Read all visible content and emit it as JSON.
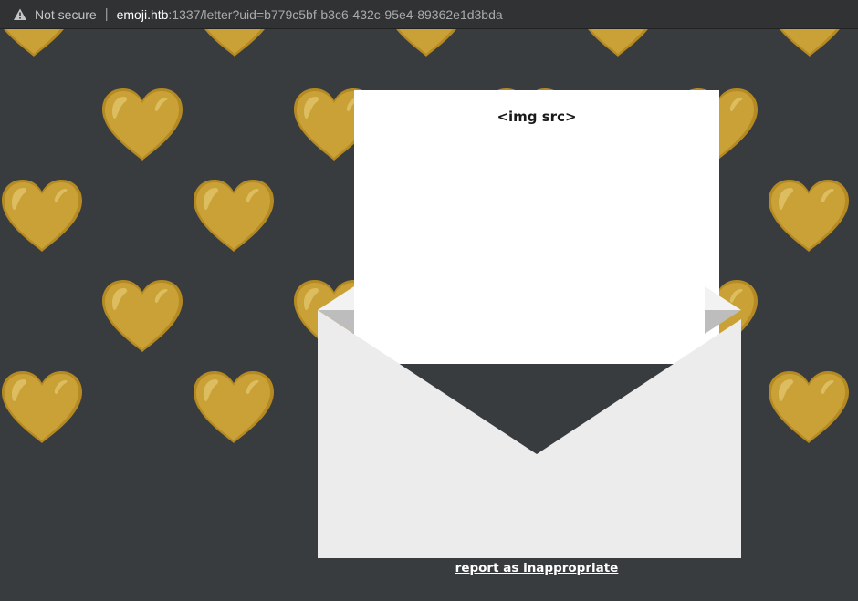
{
  "browser": {
    "security_label": "Not secure",
    "url_host": "emoji.htb",
    "url_path": ":1337/letter?uid=b779c5bf-b3c6-432c-95e4-89362e1d3bda"
  },
  "letter": {
    "text": "<img src>",
    "report_label": "report as inappropriate"
  },
  "colors": {
    "background": "#393c3e",
    "heart_gold": "#c89f2f",
    "paper": "#ffffff",
    "envelope": "#ececec"
  },
  "icons": {
    "background_pattern": "gold-heart-icon",
    "security": "warning-triangle-icon"
  }
}
